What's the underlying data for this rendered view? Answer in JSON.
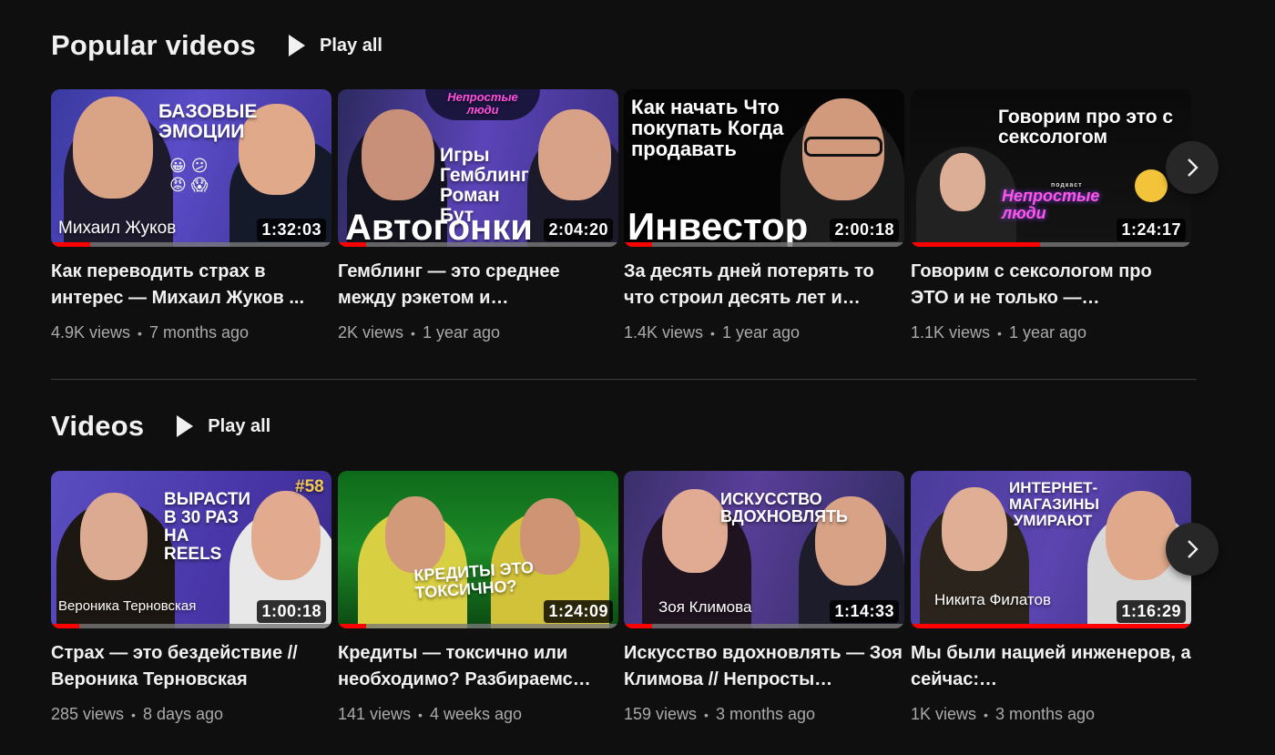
{
  "shelves": [
    {
      "title": "Popular videos",
      "play_all": "Play all",
      "videos": [
        {
          "title": "Как переводить страх в интерес — Михаил Жуков ...",
          "views": "4.9K views",
          "age": "7 months ago",
          "duration": "1:32:03",
          "progress": 0.14,
          "thumb": {
            "headline": "БАЗОВЫЕ ЭМОЦИИ",
            "caption": "Михаил Жуков"
          }
        },
        {
          "title": "Гемблинг — это среднее между рэкетом и…",
          "views": "2K views",
          "age": "1 year ago",
          "duration": "2:04:20",
          "progress": 0.1,
          "thumb": {
            "badge": "Непростые люди",
            "headline": "Игры Гемблинг Роман Бут",
            "caption": "Автогонки"
          }
        },
        {
          "title": "За десять дней потерять то что строил десять лет и…",
          "views": "1.4K views",
          "age": "1 year ago",
          "duration": "2:00:18",
          "progress": 0.1,
          "thumb": {
            "headline": "Как начать Что покупать Когда продавать",
            "caption": "Инвестор"
          }
        },
        {
          "title": "Говорим с сексологом про ЭТО и не только —…",
          "views": "1.1K views",
          "age": "1 year ago",
          "duration": "1:24:17",
          "progress": 0.46,
          "thumb": {
            "headline": "Говорим про это с сексологом",
            "badge_small": "подкаст",
            "badge": "Непростые люди"
          }
        }
      ]
    },
    {
      "title": "Videos",
      "play_all": "Play all",
      "videos": [
        {
          "title": "Страх — это бездействие // Вероника Терновская",
          "views": "285 views",
          "age": "8 days ago",
          "duration": "1:00:18",
          "progress": 0.1,
          "thumb": {
            "headline": "ВЫРАСТИ В 30 РАЗ НА REELS",
            "badge": "#58",
            "caption": "Вероника Терновская"
          }
        },
        {
          "title": "Кредиты — токсично или необходимо? Разбираемс…",
          "views": "141 views",
          "age": "4 weeks ago",
          "duration": "1:24:09",
          "progress": 0.1,
          "thumb": {
            "headline": "КРЕДИТЫ ЭТО ТОКСИЧНО?"
          }
        },
        {
          "title": "Искусство вдохновлять — Зоя Климова // Непросты…",
          "views": "159 views",
          "age": "3 months ago",
          "duration": "1:14:33",
          "progress": 0.1,
          "thumb": {
            "headline": "ИСКУССТВО ВДОХНОВЛЯТЬ",
            "caption": "Зоя Климова"
          }
        },
        {
          "title": "Мы были нацией инженеров, а сейчас:…",
          "views": "1K views",
          "age": "3 months ago",
          "duration": "1:16:29",
          "progress": 1.0,
          "thumb": {
            "headline": "ИНТЕРНЕТ- МАГАЗИНЫ УМИРАЮТ",
            "caption": "Никита Филатов"
          }
        }
      ]
    }
  ],
  "colors": {
    "background": "#0f0f0f",
    "progress": "#ff0000",
    "meta_text": "#aaaaaa"
  },
  "icons": {
    "play_all": "play-icon",
    "next": "chevron-right-icon"
  }
}
